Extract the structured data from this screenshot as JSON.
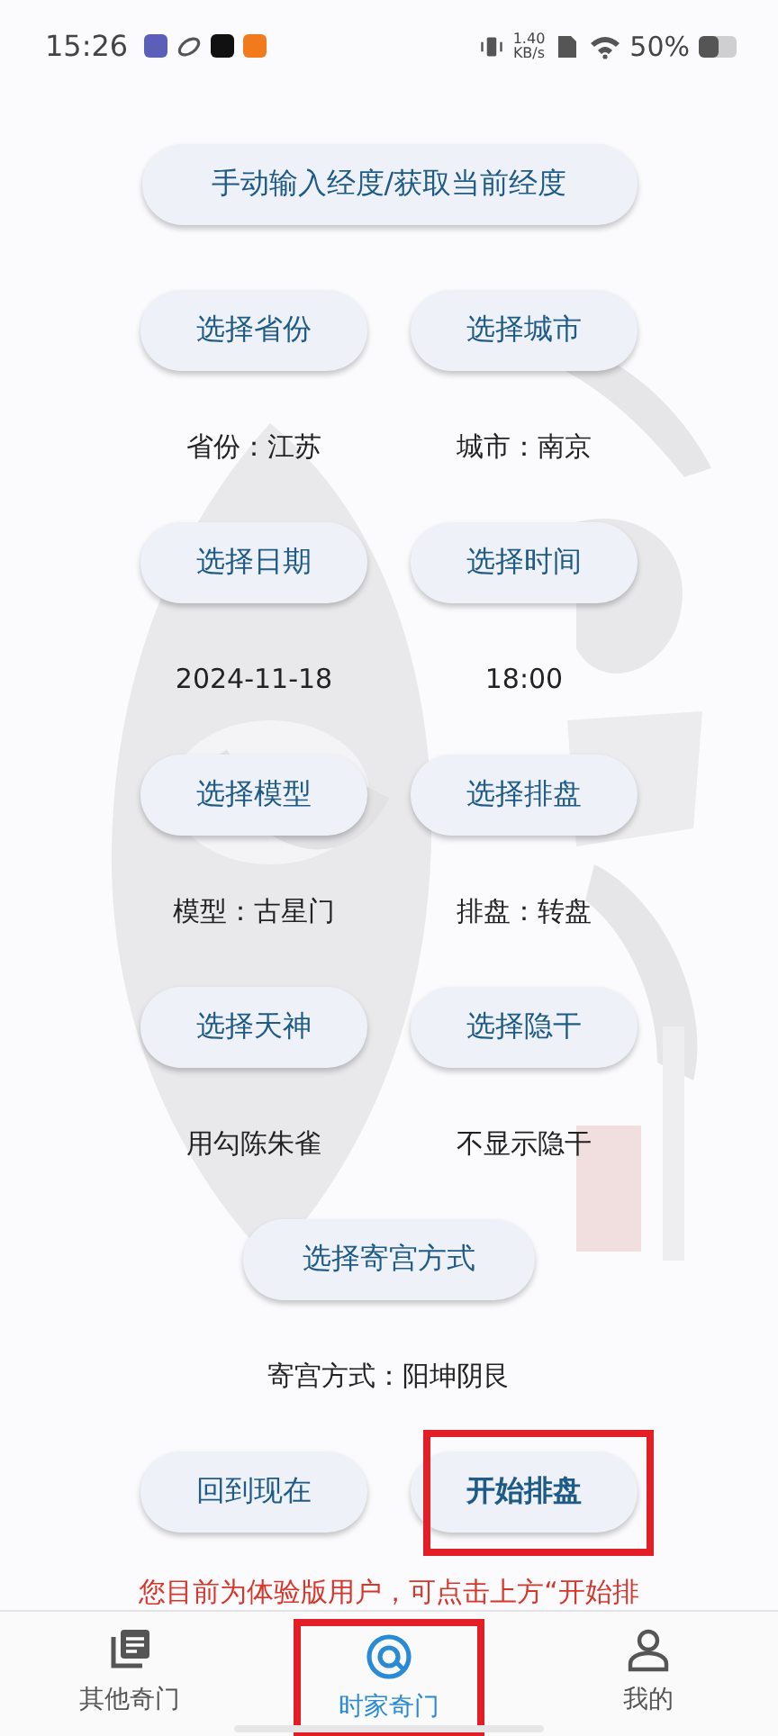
{
  "status_bar": {
    "time": "15:26",
    "net_speed": "1.40",
    "net_unit": "KB/s",
    "battery": "50%"
  },
  "top_button": {
    "label": "手动输入经度/获取当前经度"
  },
  "rows": [
    {
      "buttons": [
        {
          "label": "选择省份"
        },
        {
          "label": "选择城市"
        }
      ],
      "values": [
        "省份：江苏",
        "城市：南京"
      ]
    },
    {
      "buttons": [
        {
          "label": "选择日期"
        },
        {
          "label": "选择时间"
        }
      ],
      "values": [
        "2024-11-18",
        "18:00"
      ]
    },
    {
      "buttons": [
        {
          "label": "选择模型"
        },
        {
          "label": "选择排盘"
        }
      ],
      "values": [
        "模型：古星门",
        "排盘：转盘"
      ]
    },
    {
      "buttons": [
        {
          "label": "选择天神"
        },
        {
          "label": "选择隐干"
        }
      ],
      "values": [
        "用勾陈朱雀",
        "不显示隐干"
      ]
    }
  ],
  "palace_button": {
    "label": "选择寄宫方式"
  },
  "palace_value": "寄宫方式：阳坤阴艮",
  "actions": [
    {
      "label": "回到现在",
      "bold": false,
      "highlighted": false
    },
    {
      "label": "开始排盘",
      "bold": true,
      "highlighted": true
    }
  ],
  "notice": "您目前为体验版用户，可点击上方“开始排",
  "bottom_nav": [
    {
      "label": "其他奇门",
      "kind": "book",
      "selected": false,
      "highlighted": false
    },
    {
      "label": "时家奇门",
      "kind": "target",
      "selected": true,
      "highlighted": true
    },
    {
      "label": "我的",
      "kind": "person",
      "selected": false,
      "highlighted": false
    }
  ]
}
